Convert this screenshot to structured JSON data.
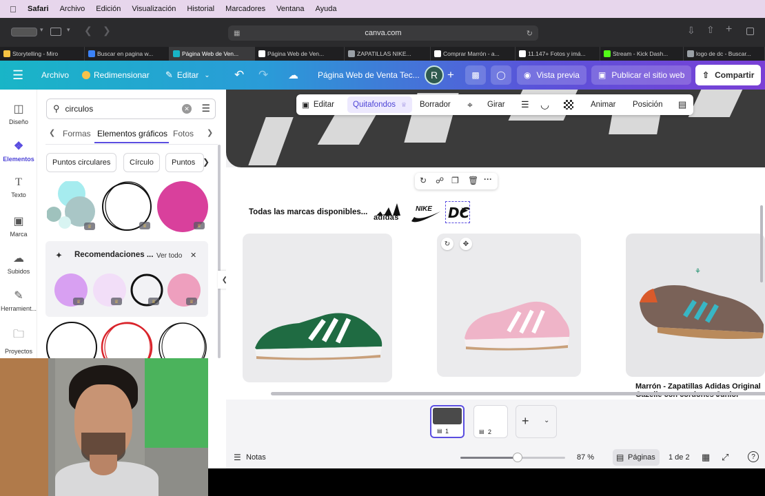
{
  "menubar": {
    "items": [
      "Safari",
      "Archivo",
      "Edición",
      "Visualización",
      "Historial",
      "Marcadores",
      "Ventana",
      "Ayuda"
    ]
  },
  "safari": {
    "url": "canva.com"
  },
  "tabs": [
    {
      "label": "Storytelling - Miro",
      "color": "#f6c343"
    },
    {
      "label": "Buscar en pagina w...",
      "color": "#3b82f6"
    },
    {
      "label": "Página Web de Ven...",
      "color": "#19b5c7",
      "active": true
    },
    {
      "label": "Página Web de Ven...",
      "color": "#ffffff"
    },
    {
      "label": "ZAPATILLAS NIKE...",
      "color": "#9aa0a6"
    },
    {
      "label": "Comprar Marrón - a...",
      "color": "#ffffff"
    },
    {
      "label": "11.147+ Fotos y imá...",
      "color": "#ffffff"
    },
    {
      "label": "Stream - Kick Dash...",
      "color": "#53fc18"
    },
    {
      "label": "logo de dc - Buscar...",
      "color": "#9aa0a6"
    }
  ],
  "canva_header": {
    "menu_icon": "hamburger-icon",
    "archivo": "Archivo",
    "redimensionar": "Redimensionar",
    "editar": "Editar",
    "title": "Página Web de Venta Tec...",
    "avatar": "R",
    "vista_previa": "Vista previa",
    "publicar": "Publicar el sitio web",
    "compartir": "Compartir"
  },
  "rail": {
    "items": [
      {
        "label": "Diseño",
        "icon": "layout-icon"
      },
      {
        "label": "Elementos",
        "icon": "elements-icon",
        "active": true
      },
      {
        "label": "Texto",
        "icon": "text-icon"
      },
      {
        "label": "Marca",
        "icon": "brand-icon"
      },
      {
        "label": "Subidos",
        "icon": "upload-icon"
      },
      {
        "label": "Herramient...",
        "icon": "tools-icon"
      },
      {
        "label": "Proyectos",
        "icon": "folder-icon"
      }
    ]
  },
  "panel": {
    "search_value": "circulos",
    "tabs": [
      "Formas",
      "Elementos gráficos",
      "Fotos"
    ],
    "active_tab": "Elementos gráficos",
    "chips": [
      "Puntos circulares",
      "Círculo",
      "Puntos"
    ],
    "recommendations_title": "Recomendaciones ...",
    "ver_todo": "Ver todo"
  },
  "context_toolbar": {
    "editar": "Editar",
    "quitafondos": "Quitafondos",
    "borrador": "Borrador",
    "girar": "Girar",
    "animar": "Animar",
    "posicion": "Posición"
  },
  "page": {
    "brands_text": "Todas las marcas disponibles...",
    "brand_logos": [
      "adidas",
      "NIKE",
      "DC"
    ],
    "product_caption_line1": "Marrón - Zapatillas Adidas Original",
    "product_caption_line2": "Gazelle con cordones Junior"
  },
  "footer": {
    "notas": "Notas",
    "zoom": "87 %",
    "paginas": "Páginas",
    "page_count": "1 de 2",
    "thumb1_num": "1",
    "thumb2_num": "2"
  },
  "colors": {
    "accent": "#5a4de0",
    "brand_gradient_start": "#19b5c7",
    "brand_gradient_end": "#7a3fd6",
    "active_quitafondos": "#ede9fe"
  }
}
